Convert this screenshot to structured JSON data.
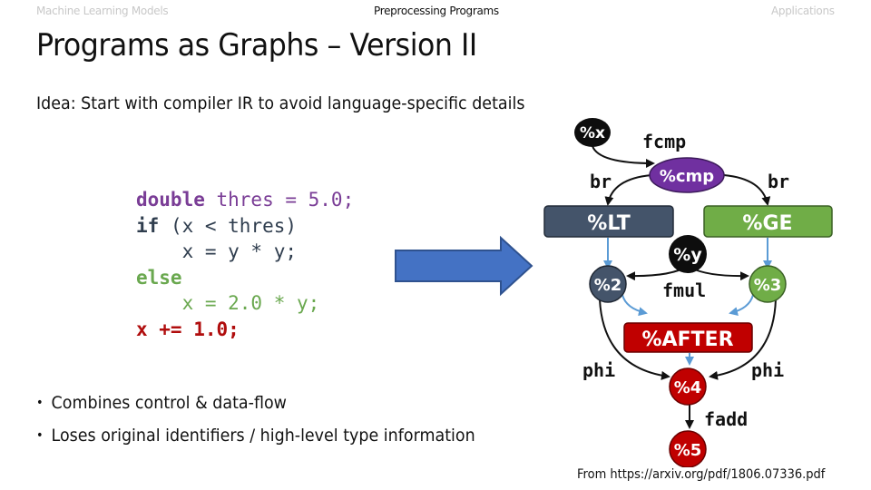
{
  "nav": {
    "left": "Machine Learning Models",
    "middle": "Preprocessing Programs",
    "right": "Applications",
    "active": "middle"
  },
  "title": "Programs as Graphs – Version II",
  "idea": "Idea: Start with compiler IR to avoid language-specific details",
  "code": {
    "lines": [
      [
        {
          "t": "double",
          "c": "purple-b"
        },
        {
          "t": " thres = 5.0;",
          "c": "purple"
        }
      ],
      [
        {
          "t": "if",
          "c": "dark-b"
        },
        {
          "t": " (x < thres)",
          "c": "dark"
        }
      ],
      [
        {
          "t": "    x = y * y;",
          "c": "dark"
        }
      ],
      [
        {
          "t": "else",
          "c": "green-b"
        }
      ],
      [
        {
          "t": "    x = 2.0 * y;",
          "c": "green"
        }
      ],
      [
        {
          "t": "x += 1.0;",
          "c": "red-b"
        }
      ]
    ]
  },
  "bullets": [
    "Combines control & data-flow",
    "Loses original identifiers / high-level type information"
  ],
  "source": "From https://arxiv.org/pdf/1806.07336.pdf",
  "graph": {
    "nodes": {
      "x": "%x",
      "cmp": "%cmp",
      "lt": "%LT",
      "ge": "%GE",
      "y": "%y",
      "n2": "%2",
      "n3": "%3",
      "after": "%AFTER",
      "n4": "%4",
      "n5": "%5"
    },
    "edge_labels": {
      "fcmp": "fcmp",
      "br_left": "br",
      "br_right": "br",
      "fmul": "fmul",
      "phi_left": "phi",
      "phi_right": "phi",
      "fadd": "fadd"
    },
    "colors": {
      "black": "#0d0d0d",
      "purple": "#7030a0",
      "slate": "#44546a",
      "green": "#70ad47",
      "red": "#c00000",
      "control_edge": "#5b9bd5",
      "arrow_fill": "#4472c4",
      "arrow_stroke": "#2f528f"
    }
  }
}
